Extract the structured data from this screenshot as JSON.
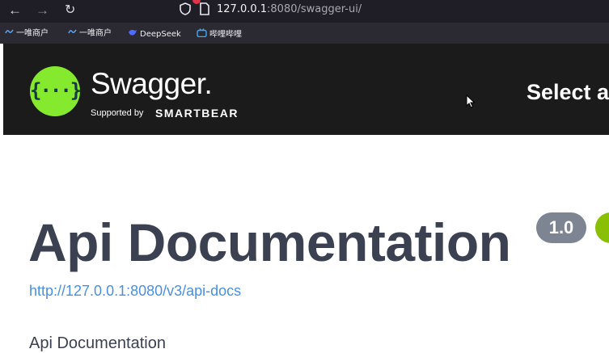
{
  "browser": {
    "url_host": "127.0.0.1",
    "url_rest": ":8080/swagger-ui/"
  },
  "bookmarks": [
    {
      "label": "一唯商户",
      "icon": "link-icon"
    },
    {
      "label": "一唯商户",
      "icon": "link-icon"
    },
    {
      "label": "DeepSeek",
      "icon": "deepseek-icon"
    },
    {
      "label": "哔哩哔哩",
      "icon": "bilibili-icon"
    }
  ],
  "topbar": {
    "logo_glyph": "{···}",
    "logo_word": "Swagger.",
    "logo_sub_pre": "Supported by",
    "logo_sub_brand": "SMARTBEAR",
    "select_label": "Select a"
  },
  "info": {
    "title": "Api Documentation",
    "version": "1.0",
    "link": "http://127.0.0.1:8080/v3/api-docs",
    "description": "Api Documentation"
  },
  "colors": {
    "topbar_bg": "#1b1b1b",
    "logo_green": "#85ea2d",
    "title_text": "#3b4151",
    "version_badge": "#7d8492",
    "oas_badge": "#89bf04",
    "link_blue": "#4990e2"
  }
}
